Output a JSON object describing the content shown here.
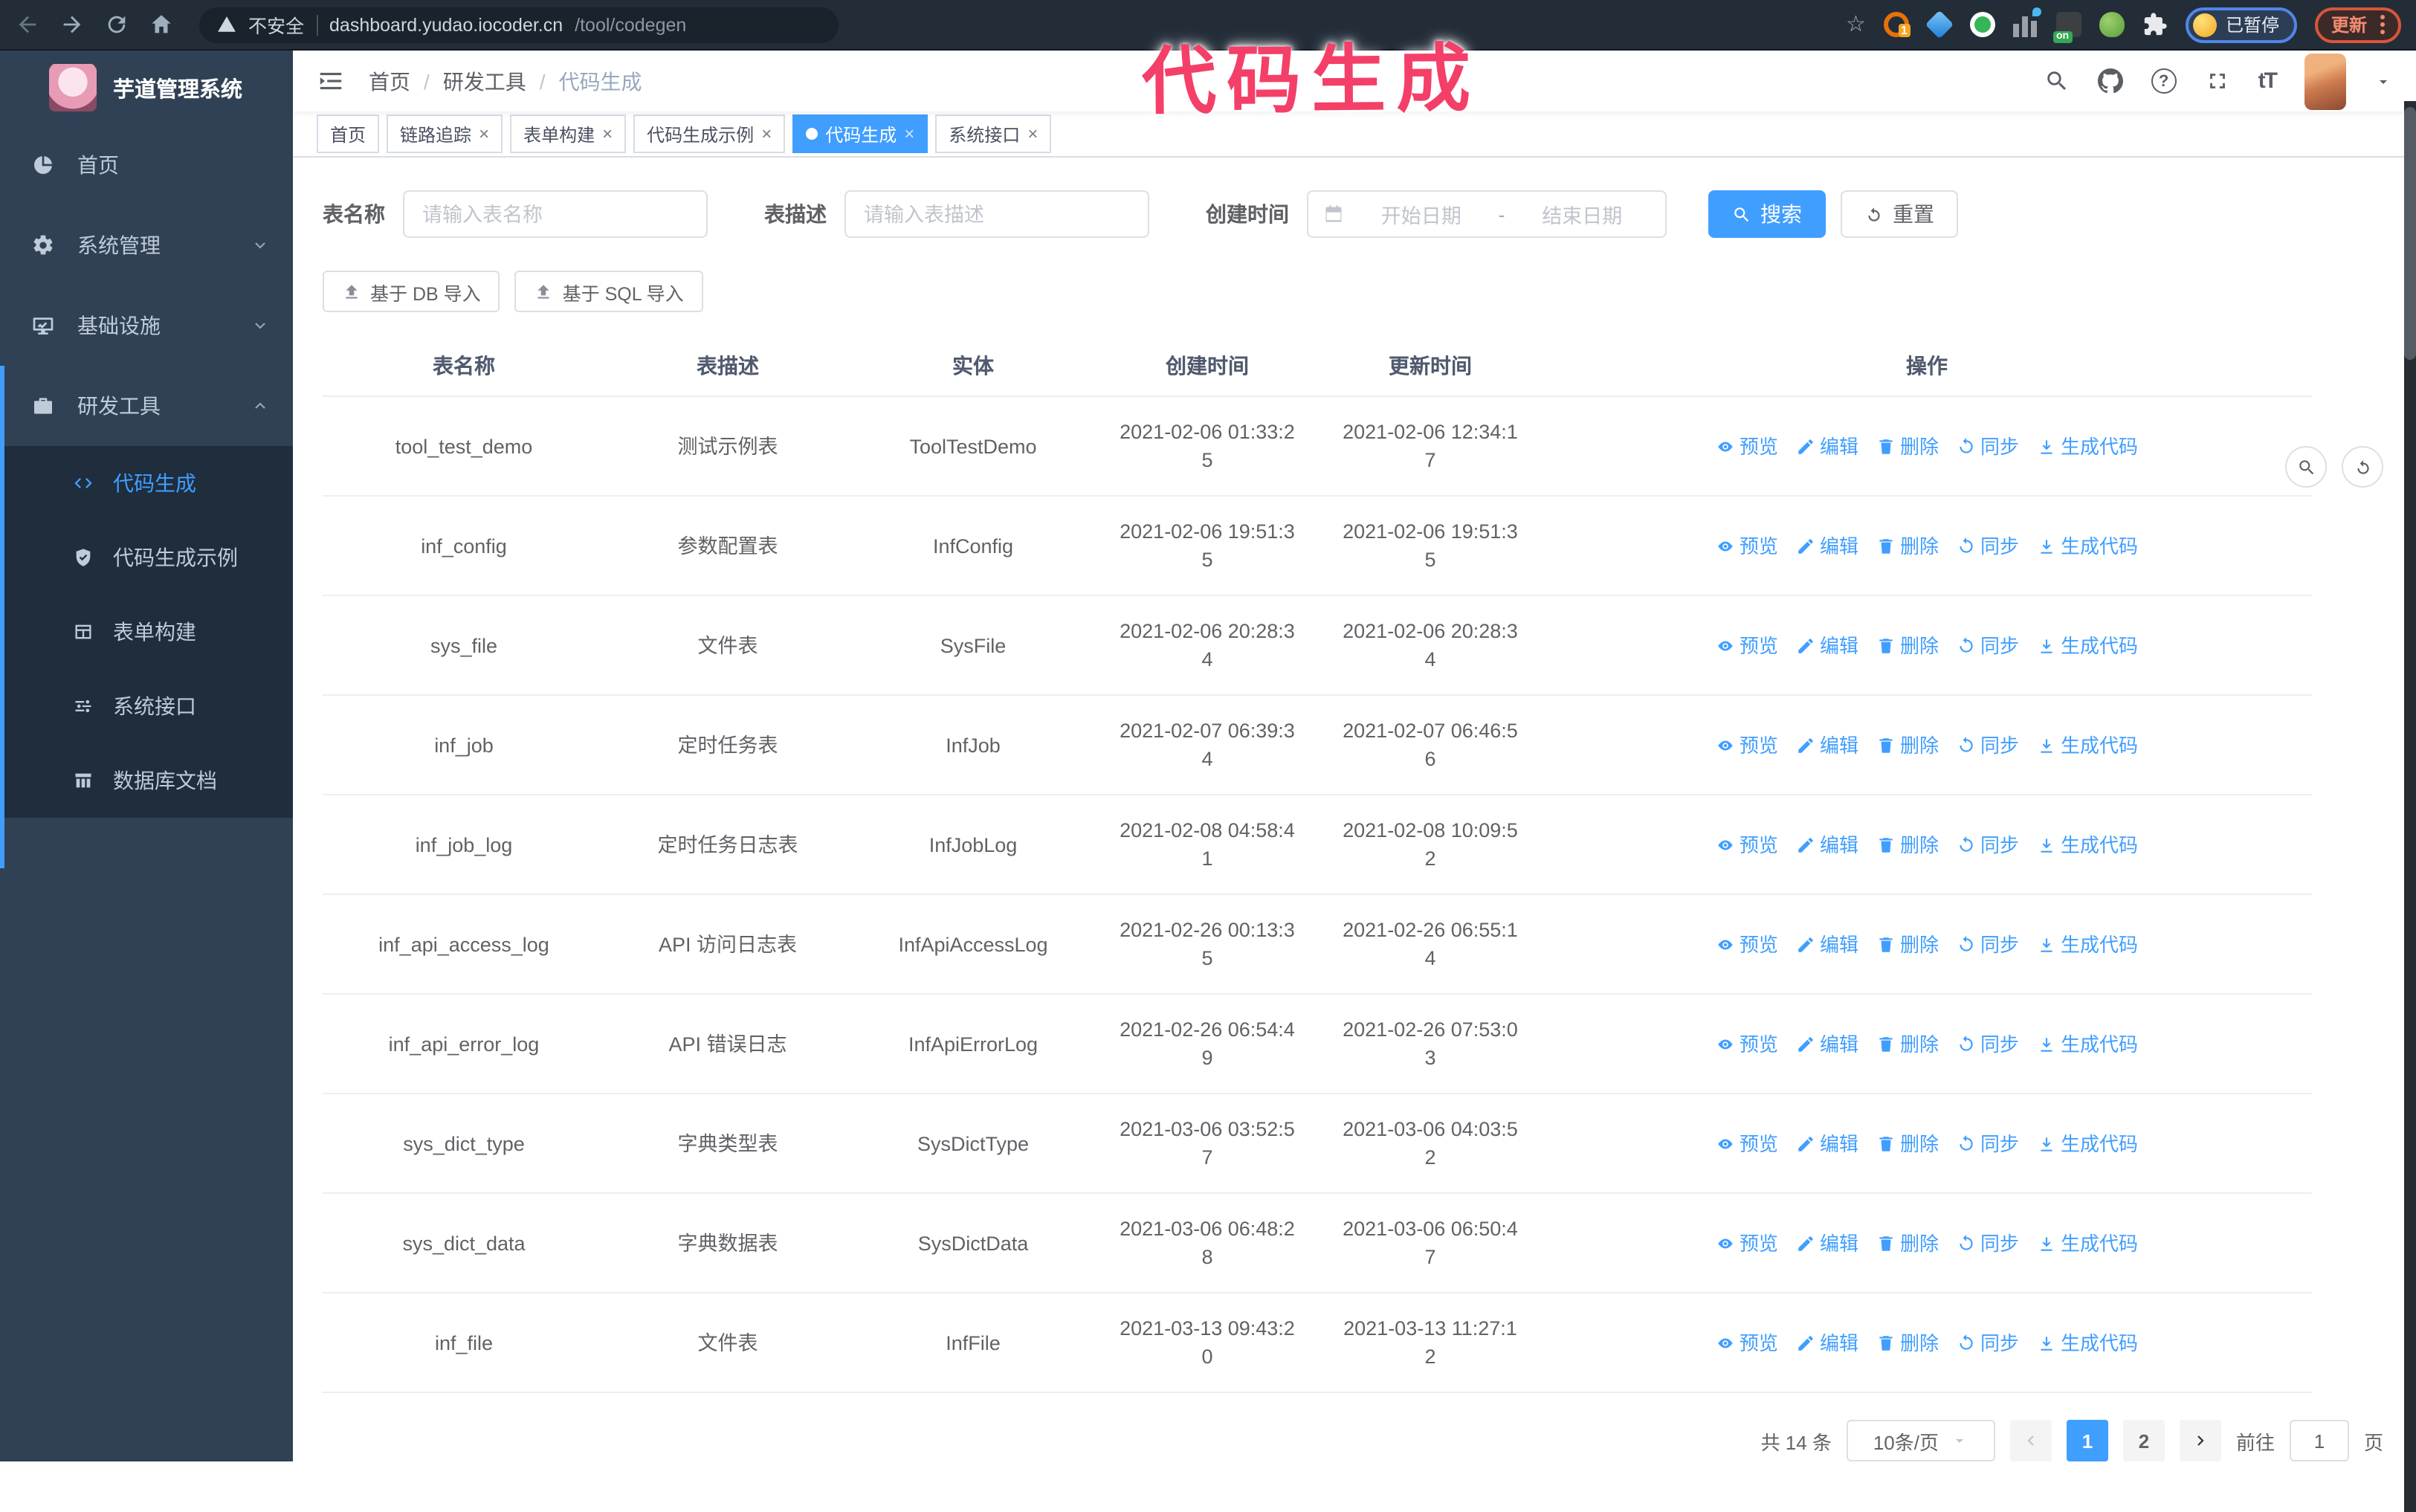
{
  "browser": {
    "security_label": "不安全",
    "url_host": "dashboard.yudao.iocoder.cn",
    "url_path": "/tool/codegen",
    "profile_label": "已暂停",
    "update_label": "更新"
  },
  "annotation": {
    "text": "代码生成",
    "color": "#f43f68"
  },
  "sidebar": {
    "app_title": "芋道管理系统",
    "items": [
      {
        "label": "首页"
      },
      {
        "label": "系统管理"
      },
      {
        "label": "基础设施"
      },
      {
        "label": "研发工具"
      }
    ],
    "submenu": [
      {
        "label": "代码生成",
        "active": true
      },
      {
        "label": "代码生成示例"
      },
      {
        "label": "表单构建"
      },
      {
        "label": "系统接口"
      },
      {
        "label": "数据库文档"
      }
    ],
    "colors": {
      "background": "#304156",
      "submenu_background": "#1f2d3d",
      "active": "#409eff"
    }
  },
  "header": {
    "breadcrumb": [
      "首页",
      "研发工具",
      "代码生成"
    ]
  },
  "tabs": [
    {
      "label": "首页",
      "closable": false,
      "active": false
    },
    {
      "label": "链路追踪",
      "closable": true,
      "active": false
    },
    {
      "label": "表单构建",
      "closable": true,
      "active": false
    },
    {
      "label": "代码生成示例",
      "closable": true,
      "active": false
    },
    {
      "label": "代码生成",
      "closable": true,
      "active": true
    },
    {
      "label": "系统接口",
      "closable": true,
      "active": false
    }
  ],
  "filters": {
    "table_name_label": "表名称",
    "table_name_placeholder": "请输入表名称",
    "table_desc_label": "表描述",
    "table_desc_placeholder": "请输入表描述",
    "create_time_label": "创建时间",
    "date_start_placeholder": "开始日期",
    "date_separator": "-",
    "date_end_placeholder": "结束日期",
    "search_label": "搜索",
    "reset_label": "重置"
  },
  "toolbar": {
    "import_db_label": "基于 DB 导入",
    "import_sql_label": "基于 SQL 导入"
  },
  "table": {
    "columns": [
      "表名称",
      "表描述",
      "实体",
      "创建时间",
      "更新时间",
      "操作"
    ],
    "actions": [
      "预览",
      "编辑",
      "删除",
      "同步",
      "生成代码"
    ],
    "rows": [
      {
        "name": "tool_test_demo",
        "desc": "测试示例表",
        "entity": "ToolTestDemo",
        "created": "2021-02-06 01:33:25",
        "updated": "2021-02-06 12:34:17"
      },
      {
        "name": "inf_config",
        "desc": "参数配置表",
        "entity": "InfConfig",
        "created": "2021-02-06 19:51:35",
        "updated": "2021-02-06 19:51:35"
      },
      {
        "name": "sys_file",
        "desc": "文件表",
        "entity": "SysFile",
        "created": "2021-02-06 20:28:34",
        "updated": "2021-02-06 20:28:34"
      },
      {
        "name": "inf_job",
        "desc": "定时任务表",
        "entity": "InfJob",
        "created": "2021-02-07 06:39:34",
        "updated": "2021-02-07 06:46:56"
      },
      {
        "name": "inf_job_log",
        "desc": "定时任务日志表",
        "entity": "InfJobLog",
        "created": "2021-02-08 04:58:41",
        "updated": "2021-02-08 10:09:52"
      },
      {
        "name": "inf_api_access_log",
        "desc": "API 访问日志表",
        "entity": "InfApiAccessLog",
        "created": "2021-02-26 00:13:35",
        "updated": "2021-02-26 06:55:14"
      },
      {
        "name": "inf_api_error_log",
        "desc": "API 错误日志",
        "entity": "InfApiErrorLog",
        "created": "2021-02-26 06:54:49",
        "updated": "2021-02-26 07:53:03"
      },
      {
        "name": "sys_dict_type",
        "desc": "字典类型表",
        "entity": "SysDictType",
        "created": "2021-03-06 03:52:57",
        "updated": "2021-03-06 04:03:52"
      },
      {
        "name": "sys_dict_data",
        "desc": "字典数据表",
        "entity": "SysDictData",
        "created": "2021-03-06 06:48:28",
        "updated": "2021-03-06 06:50:47"
      },
      {
        "name": "inf_file",
        "desc": "文件表",
        "entity": "InfFile",
        "created": "2021-03-13 09:43:20",
        "updated": "2021-03-13 11:27:12"
      }
    ]
  },
  "pagination": {
    "total_label": "共 14 条",
    "page_size_label": "10条/页",
    "pages": [
      "1",
      "2"
    ],
    "active_page": "1",
    "goto_label": "前往",
    "goto_value": "1",
    "page_suffix_label": "页"
  },
  "colors": {
    "accent": "#409eff",
    "annotation_pink": "#f43f68",
    "chrome_dark": "#232d38"
  }
}
